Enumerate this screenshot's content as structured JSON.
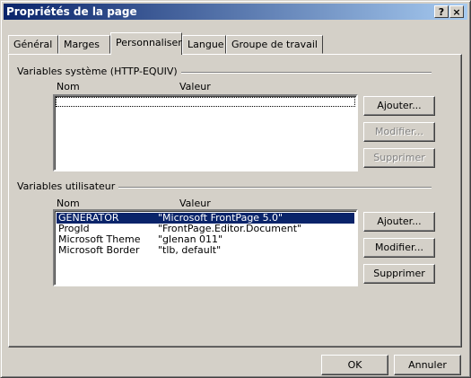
{
  "window": {
    "title": "Propriétés de la page",
    "help_label": "?",
    "close_label": "×"
  },
  "tabs": [
    {
      "label": "Général"
    },
    {
      "label": "Marges"
    },
    {
      "label": "Personnaliser"
    },
    {
      "label": "Langue"
    },
    {
      "label": "Groupe de travail"
    }
  ],
  "system_vars": {
    "label": "Variables système (HTTP-EQUIV)",
    "col_name": "Nom",
    "col_value": "Valeur",
    "add_label": "Ajouter...",
    "modify_label": "Modifier...",
    "delete_label": "Supprimer"
  },
  "user_vars": {
    "label": "Variables utilisateur",
    "col_name": "Nom",
    "col_value": "Valeur",
    "rows": [
      {
        "name": "GENERATOR",
        "value": "\"Microsoft FrontPage 5.0\""
      },
      {
        "name": "ProgId",
        "value": "\"FrontPage.Editor.Document\""
      },
      {
        "name": "Microsoft Theme",
        "value": "\"glenan 011\""
      },
      {
        "name": "Microsoft Border",
        "value": "\"tlb, default\""
      }
    ],
    "add_label": "Ajouter...",
    "modify_label": "Modifier...",
    "delete_label": "Supprimer"
  },
  "footer": {
    "ok_label": "OK",
    "cancel_label": "Annuler"
  }
}
